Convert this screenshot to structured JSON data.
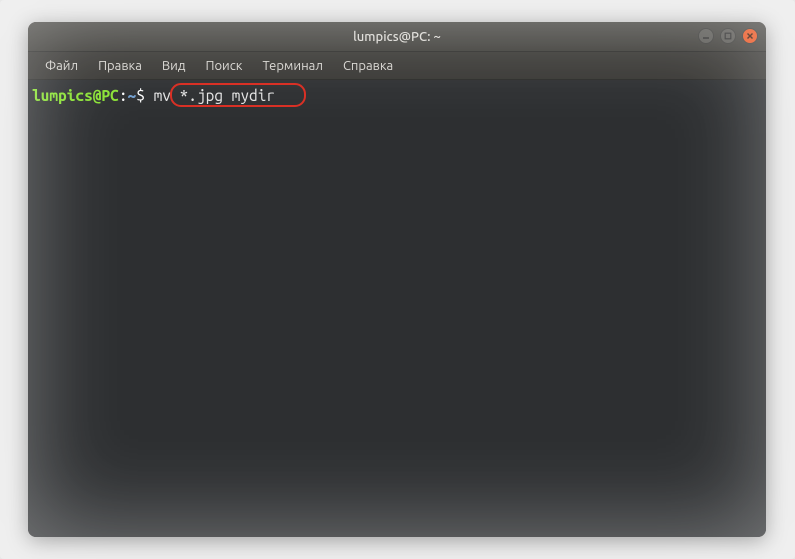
{
  "window": {
    "title": "lumpics@PC: ~"
  },
  "menubar": {
    "items": [
      "Файл",
      "Правка",
      "Вид",
      "Поиск",
      "Терминал",
      "Справка"
    ]
  },
  "prompt": {
    "user_host": "lumpics@PC",
    "separator": ":",
    "path": "~",
    "symbol": "$"
  },
  "command": "mv *.jpg mydir"
}
